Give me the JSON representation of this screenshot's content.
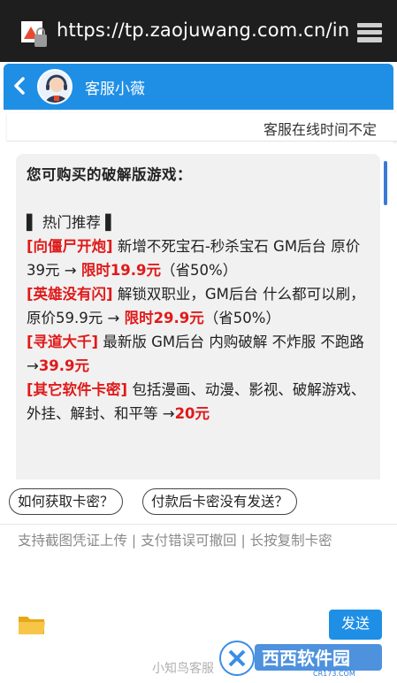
{
  "browser": {
    "url": "https://tp.zaojuwang.com.cn/in"
  },
  "header": {
    "title": "客服小薇"
  },
  "notice": {
    "text": "客服在线时间不定"
  },
  "message": {
    "title": "您可购买的破解版游戏：",
    "section": "▌ 热门推荐 ▌",
    "items": [
      {
        "tag": "[向僵尸开炮]",
        "desc": " 新增不死宝石-秒杀宝石 GM后台 原价39元 → ",
        "price": "限时19.9元",
        "after": "（省50%）"
      },
      {
        "tag": "[英雄没有闪]",
        "desc": " 解锁双职业，GM后台 什么都可以刷，原价59.9元 → ",
        "price": "限时29.9元",
        "after": "（省50%）"
      },
      {
        "tag": "[寻道大千]",
        "desc": " 最新版 GM后台 内购破解 不炸服 不跑路 →",
        "price": "39.9元",
        "after": ""
      },
      {
        "tag": "[其它软件卡密]",
        "desc": " 包括漫画、动漫、影视、破解游戏、外挂、解封、和平等 →",
        "price": "20元",
        "after": ""
      }
    ]
  },
  "quick_replies": [
    "如何获取卡密？",
    "付款后卡密没有发送？"
  ],
  "input": {
    "hint": "支持截图凭证上传 | 支付错误可撤回 | 长按复制卡密"
  },
  "send_label": "发送",
  "footer": "小知鸟客服",
  "watermark": {
    "brand": "西西软件园",
    "site": "CR173.COM"
  },
  "colors": {
    "header_blue": "#1f8fe6",
    "accent_red": "#e01a1a",
    "browser_bar": "#1e1e1e"
  }
}
